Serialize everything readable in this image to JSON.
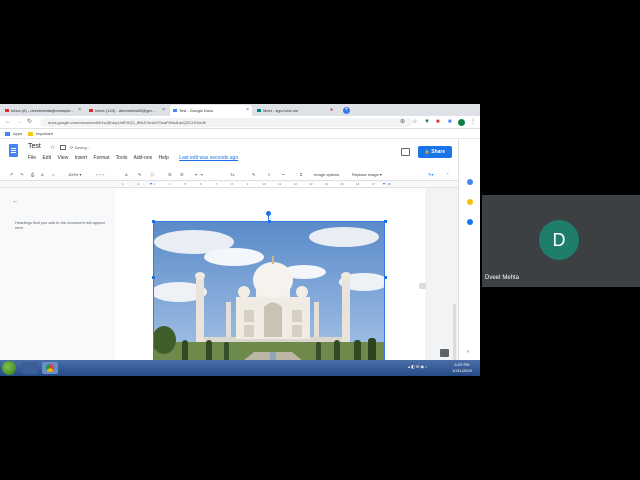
{
  "browser": {
    "tabs": [
      {
        "label": "Inbox (8) - dveetmehta@example...",
        "icon_color": "#d93025",
        "active": false
      },
      {
        "label": "Inbox (123) - dmumehta00@gm...",
        "icon_color": "#d93025",
        "active": false
      },
      {
        "label": "Test - Google Docs",
        "icon_color": "#4285f4",
        "active": true
      },
      {
        "label": "Meet - sgn-hvbv-cin",
        "icon_color": "#00897b",
        "active": false
      }
    ],
    "new_tab": "+",
    "url": "docs.google.com/document/d/1wJjKaqrUnRYlQ3_tBKA7kn64Y0saFDfsd1anQECHO/edit",
    "bookmarks": {
      "apps": "Apps",
      "important": "Important"
    }
  },
  "docs": {
    "title": "Test",
    "saving": "Saving...",
    "menu": [
      "File",
      "Edit",
      "View",
      "Insert",
      "Format",
      "Tools",
      "Add-ons",
      "Help"
    ],
    "last_edit": "Last edit was seconds ago",
    "share_label": "Share",
    "toolbar": {
      "zoom": "100%",
      "image_options": "Image options",
      "replace_image": "Replace image ▾"
    },
    "ruler_ticks": [
      "1",
      "2",
      "3",
      "4",
      "5",
      "6",
      "7",
      "8",
      "9",
      "10",
      "11",
      "12",
      "13",
      "14",
      "15",
      "16",
      "17",
      "18"
    ],
    "outline_text": "Headings that you add to the document will appear here.",
    "accent": "#1a73e8"
  },
  "taskbar": {
    "time": "6:29 PM",
    "date": "10/11/2020"
  },
  "meet": {
    "participant_initial": "D",
    "participant_name": "Dveet Mehta",
    "avatar_color": "#1e7e6b"
  }
}
